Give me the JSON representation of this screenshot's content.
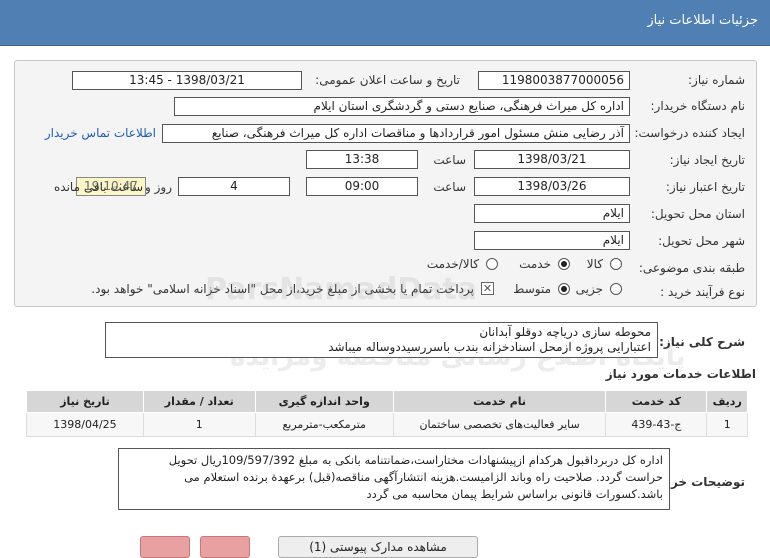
{
  "header": {
    "title": "جزئیات اطلاعات نیاز"
  },
  "labels": {
    "need_number": "شماره نیاز:",
    "announce_datetime": "تاریخ و ساعت اعلان عمومی:",
    "buyer_org": "نام دستگاه خریدار:",
    "requester": "ایجاد کننده درخواست:",
    "contact_link": "اطلاعات تماس خریدار",
    "need_date": "تاریخ ایجاد نیاز:",
    "time": "ساعت",
    "validity_date": "تاریخ اعتبار نیاز:",
    "days_and": "روز و",
    "remaining": "ساعت باقی مانده",
    "province": "استان محل تحویل:",
    "city": "شهر محل تحویل:",
    "category": "طبقه بندی موضوعی:",
    "purchase_type": "نوع فرآیند خرید :",
    "general_desc": "شرح کلی نیاز:",
    "services_info": "اطلاعات خدمات مورد نیاز",
    "explanations": "توضیحات خریدار:"
  },
  "fields": {
    "need_number": "1198003877000056",
    "announce_datetime": "1398/03/21 - 13:45",
    "buyer_org": "اداره کل میراث فرهنگی، صنایع دستی و گردشگری استان ایلام",
    "requester": "آذر رضایی منش مسئول امور قراردادها و مناقصات اداره کل میراث فرهنگی، صنایع",
    "need_date": "1398/03/21",
    "need_time": "13:38",
    "validity_date": "1398/03/26",
    "validity_time": "09:00",
    "days": "4",
    "remaining_time": "19:10:47",
    "province": "ایلام",
    "city": "ایلام"
  },
  "category": {
    "options": [
      "کالا",
      "خدمت",
      "کالا/خدمت"
    ],
    "selected": "خدمت"
  },
  "purchase": {
    "options": [
      "جزیی",
      "متوسط"
    ],
    "selected": "متوسط",
    "payment_note": "پرداخت تمام یا بخشی از مبلغ خرید،از محل \"اسناد خزانه اسلامی\" خواهد بود."
  },
  "general_desc": {
    "line1": "محوطه سازی دریاچه دوقلو آبدانان",
    "line2": "اعتبارایی پروژه ازمحل اسنادخزانه بندب باسررسیددوساله میباشد"
  },
  "table": {
    "headers": [
      "ردیف",
      "کد خدمت",
      "نام خدمت",
      "واحد اندازه گیری",
      "تعداد / مقدار",
      "تاریخ نیاز"
    ],
    "rows": [
      [
        "1",
        "ج-43-439",
        "سایر فعالیت‌های تخصصی ساختمان",
        "مترمکعب-مترمربع",
        "1",
        "1398/04/25"
      ]
    ]
  },
  "explanations": {
    "line1": "اداره کل دربرداقبول هرکدام ازپیشنهادات مختاراست،ضمانتنامه بانکی به مبلغ 109/597/392ریال تحویل",
    "line2": "حراست گردد. صلاحیت راه وباند الزامیست.هزینه انتشارآگهی مناقصه(قبل) برعهدة برنده استعلام می",
    "line3": "باشد.کسورات قانونی براساس شرایط پیمان محاسبه می گردد"
  },
  "watermark": {
    "line1": "پایگاه اطلاع رسانی مناقصه ومزایده",
    "line2": "ParsNamadData",
    "line3": "۰۲۱-۸۸۳۴۹۶۷۰"
  },
  "bottom": {
    "middle_text": "مشاهده مدارک پیوستی (1)"
  },
  "colors": {
    "header_bg": "#4f7fb3",
    "link": "#1f5fb5",
    "remaining_bg": "#fdf6c7"
  }
}
